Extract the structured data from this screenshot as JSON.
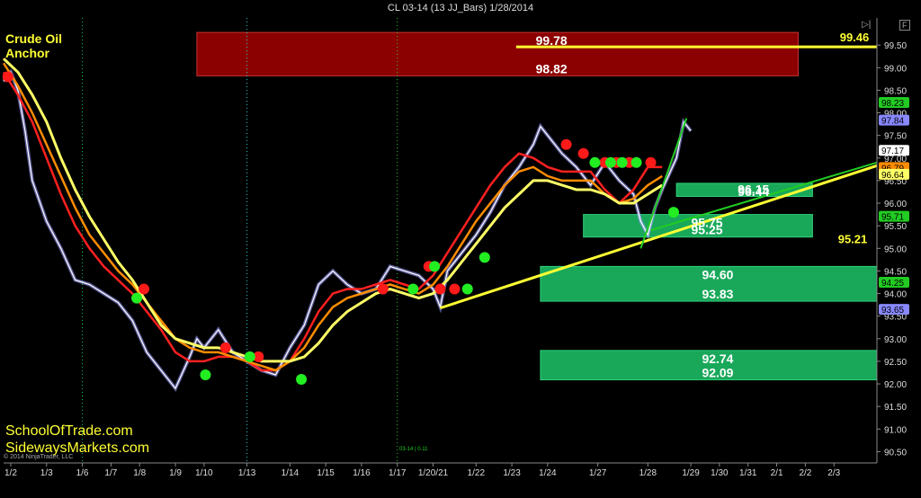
{
  "window": {
    "title": "CL 03-14 (13 JJ_Bars)  1/28/2014",
    "copyright": "© 2014 NinjaTrader, LLC",
    "collapse_icon": "panel-collapse-icon",
    "f_label": "F"
  },
  "annotations": {
    "crude_oil": "Crude Oil",
    "anchor": "Anchor",
    "brand1": "SchoolOfTrade.com",
    "brand2": "SidewaysMarkets.com",
    "center_tag": "03-14 | 0.11"
  },
  "colors": {
    "bg": "#000000",
    "resistance_zone": "#8b0000",
    "support_zone": "#19a85a",
    "yellow": "#ffff33",
    "price": "#ffffff",
    "ema_red": "#ff2020",
    "ema_orange": "#ff8c00",
    "sma_yellow": "#ffff66",
    "trend_green": "#22cc22",
    "dots_blue": "#7777ff"
  },
  "chart_data": {
    "type": "line",
    "title": "CL 03-14 (13 JJ_Bars)  1/28/2014",
    "xlabel": "",
    "ylabel": "",
    "ylim": [
      90.25,
      100.1
    ],
    "y_ticks": [
      "99.50",
      "99.00",
      "98.50",
      "98.00",
      "97.50",
      "97.00",
      "96.50",
      "96.00",
      "95.50",
      "95.00",
      "94.50",
      "94.00",
      "93.50",
      "93.00",
      "92.50",
      "92.00",
      "91.50",
      "91.00",
      "90.50"
    ],
    "y_tick_values": [
      99.5,
      99.0,
      98.5,
      98.0,
      97.5,
      97.0,
      96.5,
      96.0,
      95.5,
      95.0,
      94.5,
      94.0,
      93.5,
      93.0,
      92.5,
      92.0,
      91.5,
      91.0,
      90.5
    ],
    "x_ticks": [
      "1/2",
      "1/3",
      "1/6",
      "1/7",
      "1/8",
      "1/9",
      "1/10",
      "1/13",
      "1/14",
      "1/15",
      "1/16",
      "1/17",
      "1/20/21",
      "1/22",
      "1/23",
      "1/24",
      "1/27",
      "1/28",
      "1/29",
      "1/30",
      "1/31",
      "2/1",
      "2/2",
      "2/3"
    ],
    "x_tick_pos": [
      0.5,
      3,
      5.5,
      7.5,
      9.5,
      12,
      14,
      17,
      20,
      22.5,
      25,
      27.5,
      30,
      33,
      35.5,
      38,
      41.5,
      45,
      48,
      50,
      52,
      54,
      56,
      58
    ],
    "x_range": [
      0,
      61
    ],
    "grid": false,
    "zones": [
      {
        "kind": "resistance",
        "top": 99.78,
        "bottom": 98.82,
        "x0": 13.5,
        "x1": 55.5,
        "top_label": "99.78",
        "bottom_label": "98.82"
      },
      {
        "kind": "support",
        "top": 96.44,
        "bottom": 96.15,
        "x0": 47,
        "x1": 56.5,
        "top_label": "96.44",
        "bottom_label": "96.15"
      },
      {
        "kind": "support",
        "top": 95.75,
        "bottom": 95.25,
        "x0": 40.5,
        "x1": 56.5,
        "top_label": "95.75",
        "bottom_label": "95.25"
      },
      {
        "kind": "support",
        "top": 94.6,
        "bottom": 93.83,
        "x0": 37.5,
        "x1": 61,
        "top_label": "94.60",
        "bottom_label": "93.83"
      },
      {
        "kind": "support",
        "top": 92.74,
        "bottom": 92.09,
        "x0": 37.5,
        "x1": 61,
        "top_label": "92.74",
        "bottom_label": "92.09"
      }
    ],
    "level_labels": [
      {
        "label": "99.46",
        "value": 99.46
      },
      {
        "label": "95.21",
        "value": 95.21
      }
    ],
    "yellow_trendlines": [
      {
        "x0": 35.8,
        "y0": 99.46,
        "x1": 61,
        "y0b": 99.46
      },
      {
        "x0": 30.5,
        "y0": 93.68,
        "x1": 61,
        "y0b": 96.83
      }
    ],
    "green_trendlines": [
      {
        "x0": 44.5,
        "y0": 95.0,
        "x1": 47.7,
        "y0b": 97.88
      },
      {
        "x0": 45.2,
        "y0": 95.4,
        "x1": 61,
        "y0b": 96.9
      }
    ],
    "price": {
      "x": [
        0,
        0.5,
        1,
        1.5,
        2,
        3,
        4,
        5,
        6,
        7,
        8,
        9,
        10,
        11,
        12,
        13,
        13.5,
        14,
        15,
        16,
        17,
        18,
        19,
        20,
        21,
        22,
        23,
        24,
        25,
        26,
        27,
        28,
        29,
        30,
        30.5,
        31,
        32,
        33,
        34,
        35,
        36,
        37,
        37.5,
        38,
        39,
        40,
        41,
        42,
        43,
        44,
        44.5,
        45,
        45.5,
        46,
        47,
        47.5,
        48
      ],
      "y": [
        98.7,
        98.9,
        98.5,
        97.6,
        96.5,
        95.6,
        95.0,
        94.3,
        94.2,
        94.0,
        93.8,
        93.4,
        92.7,
        92.3,
        91.9,
        92.6,
        93.0,
        92.8,
        93.2,
        92.7,
        92.5,
        92.3,
        92.2,
        92.8,
        93.3,
        94.2,
        94.5,
        94.2,
        94.0,
        94.1,
        94.6,
        94.5,
        94.4,
        94.1,
        93.7,
        94.5,
        94.9,
        95.3,
        95.8,
        96.4,
        96.8,
        97.3,
        97.7,
        97.5,
        97.1,
        96.8,
        96.4,
        96.9,
        96.5,
        96.2,
        95.6,
        95.3,
        95.9,
        96.3,
        97.0,
        97.8,
        97.6
      ]
    },
    "series": [
      {
        "name": "ema_red",
        "values": [
          98.9,
          98.4,
          97.8,
          97.0,
          96.2,
          95.5,
          95.0,
          94.6,
          94.3,
          94.0,
          93.6,
          93.2,
          92.7,
          92.5,
          92.5,
          92.6,
          92.6,
          92.5,
          92.3,
          92.3,
          92.5,
          93.0,
          93.6,
          94.0,
          94.1,
          94.1,
          94.2,
          94.3,
          94.2,
          94.1,
          94.4,
          94.9,
          95.4,
          95.9,
          96.4,
          96.8,
          97.1,
          97.0,
          96.8,
          96.7,
          96.7,
          96.7,
          96.3,
          96.0,
          96.3,
          96.8,
          96.8
        ]
      },
      {
        "name": "ema_orange",
        "values": [
          99.1,
          98.6,
          98.0,
          97.3,
          96.6,
          95.9,
          95.3,
          94.9,
          94.5,
          94.2,
          93.8,
          93.4,
          93.0,
          92.8,
          92.7,
          92.7,
          92.6,
          92.5,
          92.4,
          92.3,
          92.5,
          92.8,
          93.3,
          93.7,
          93.9,
          94.0,
          94.1,
          94.2,
          94.1,
          94.0,
          94.2,
          94.6,
          95.1,
          95.6,
          96.0,
          96.4,
          96.7,
          96.8,
          96.6,
          96.5,
          96.5,
          96.5,
          96.2,
          96.0,
          96.1,
          96.4,
          96.6
        ]
      },
      {
        "name": "sma_yellow",
        "values": [
          99.2,
          98.9,
          98.4,
          97.8,
          97.0,
          96.3,
          95.7,
          95.2,
          94.7,
          94.3,
          93.8,
          93.3,
          93.0,
          92.9,
          92.8,
          92.8,
          92.7,
          92.6,
          92.5,
          92.5,
          92.5,
          92.6,
          92.9,
          93.3,
          93.6,
          93.8,
          94.0,
          94.1,
          94.0,
          93.9,
          94.0,
          94.3,
          94.7,
          95.1,
          95.5,
          95.9,
          96.2,
          96.5,
          96.5,
          96.4,
          96.3,
          96.3,
          96.2,
          96.0,
          96.0,
          96.2,
          96.4
        ]
      }
    ],
    "series_x": [
      0,
      1,
      2,
      3,
      4,
      5,
      6,
      7,
      8,
      9,
      10,
      11,
      12,
      13,
      14,
      15,
      16,
      17,
      18,
      19,
      20,
      21,
      22,
      23,
      24,
      25,
      26,
      27,
      28,
      29,
      30,
      31,
      32,
      33,
      34,
      35,
      36,
      37,
      38,
      39,
      40,
      41,
      42,
      43,
      44,
      45,
      46
    ],
    "dots_red": [
      [
        0.3,
        98.8
      ],
      [
        9.8,
        94.1
      ],
      [
        15.5,
        92.8
      ],
      [
        17.8,
        92.6
      ],
      [
        26.5,
        94.1
      ],
      [
        29.7,
        94.6
      ],
      [
        30.5,
        94.1
      ],
      [
        31.5,
        94.1
      ],
      [
        39.3,
        97.3
      ],
      [
        40.5,
        97.1
      ],
      [
        42,
        96.9
      ],
      [
        42.8,
        96.9
      ],
      [
        43.7,
        96.9
      ],
      [
        45.2,
        96.9
      ]
    ],
    "dots_green": [
      [
        9.3,
        93.9
      ],
      [
        14.1,
        92.2
      ],
      [
        17.2,
        92.6
      ],
      [
        20.8,
        92.1
      ],
      [
        28.6,
        94.1
      ],
      [
        30.1,
        94.6
      ],
      [
        32.4,
        94.1
      ],
      [
        33.6,
        94.8
      ],
      [
        41.3,
        96.9
      ],
      [
        42.4,
        96.9
      ],
      [
        43.2,
        96.9
      ],
      [
        44.2,
        96.9
      ],
      [
        46.8,
        95.8
      ]
    ],
    "right_price_badges": [
      {
        "label": "98.23",
        "value": 98.23,
        "color": "#22cc22"
      },
      {
        "label": "97.84",
        "value": 97.84,
        "color": "#8888ff"
      },
      {
        "label": "97.17",
        "value": 97.17,
        "color": "#ffffff"
      },
      {
        "label": "96.79",
        "value": 96.79,
        "color": "#ff8c00"
      },
      {
        "label": "96.64",
        "value": 96.64,
        "color": "#ffff66"
      },
      {
        "label": "95.71",
        "value": 95.71,
        "color": "#22cc22"
      },
      {
        "label": "94.25",
        "value": 94.25,
        "color": "#22cc22"
      },
      {
        "label": "93.65",
        "value": 93.65,
        "color": "#8888ff"
      }
    ]
  }
}
